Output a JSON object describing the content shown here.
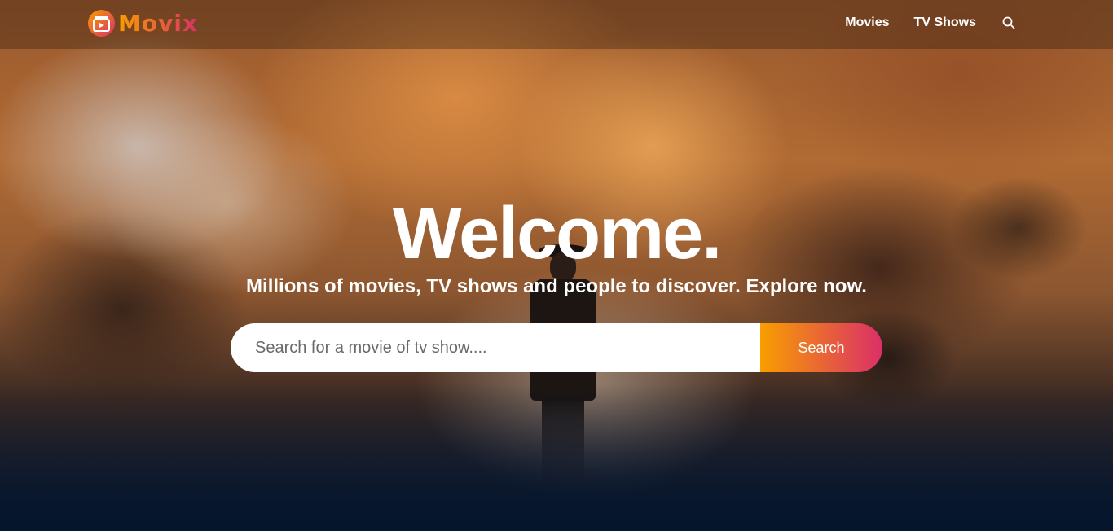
{
  "header": {
    "brand": "Movix",
    "nav": {
      "movies": "Movies",
      "tv_shows": "TV Shows"
    },
    "icons": {
      "logo": "clapperboard-play-icon",
      "search": "search-icon"
    }
  },
  "hero": {
    "title": "Welcome.",
    "subtitle": "Millions of movies, TV shows and people to discover. Explore now.",
    "search": {
      "placeholder": "Search for a movie of tv show....",
      "value": "",
      "button_label": "Search"
    }
  },
  "colors": {
    "gradient_start": "#f89e00",
    "gradient_end": "#da2f68",
    "background_dark": "#04152d"
  }
}
